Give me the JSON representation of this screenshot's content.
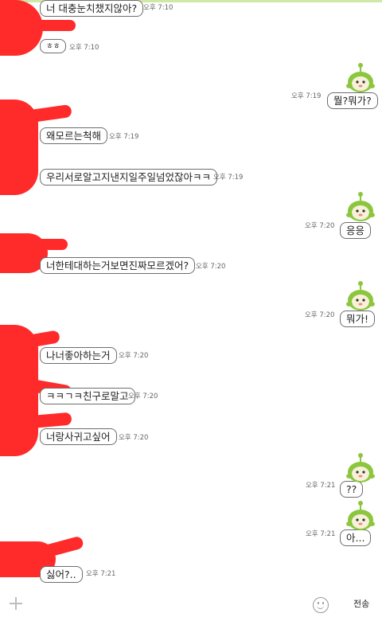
{
  "colors": {
    "redaction": "#ff2b2b",
    "bubble_border": "#6d6d6d",
    "avatar_green": "#8cc63f"
  },
  "messages": [
    {
      "side": "left",
      "text": "너 대충눈치챘지않아?",
      "time": "오후 7:10"
    },
    {
      "side": "left",
      "text": "ㅎㅎ",
      "time": "오후 7:10"
    },
    {
      "side": "right",
      "text": "뭘?뭐가?",
      "time": "오후 7:19"
    },
    {
      "side": "left",
      "text": "왜모르는척해",
      "time": "오후 7:19"
    },
    {
      "side": "left",
      "text": "우리서로알고지낸지일주일넘었잖아ㅋㅋ",
      "time": "오후 7:19"
    },
    {
      "side": "right",
      "text": "응응",
      "time": "오후 7:20"
    },
    {
      "side": "left",
      "text": "너한테대하는거보면진짜모르겠어?",
      "time": "오후 7:20"
    },
    {
      "side": "right",
      "text": "뭐가!",
      "time": "오후 7:20"
    },
    {
      "side": "left",
      "text": "나너좋아하는거",
      "time": "오후 7:20"
    },
    {
      "side": "left",
      "text": "ㅋㅋㄱㅋ친구로말고",
      "time": "오후 7:20"
    },
    {
      "side": "left",
      "text": "너랑사귀고싶어",
      "time": "오후 7:20"
    },
    {
      "side": "right",
      "text": "??",
      "time": "오후 7:21"
    },
    {
      "side": "right",
      "text": "아...",
      "time": "오후 7:21"
    },
    {
      "side": "left",
      "text": "싫어?..",
      "time": "오후 7:21"
    }
  ],
  "input_bar": {
    "send_label": "전송",
    "plus_icon": "plus-icon",
    "emoji_icon": "smiley-icon"
  }
}
